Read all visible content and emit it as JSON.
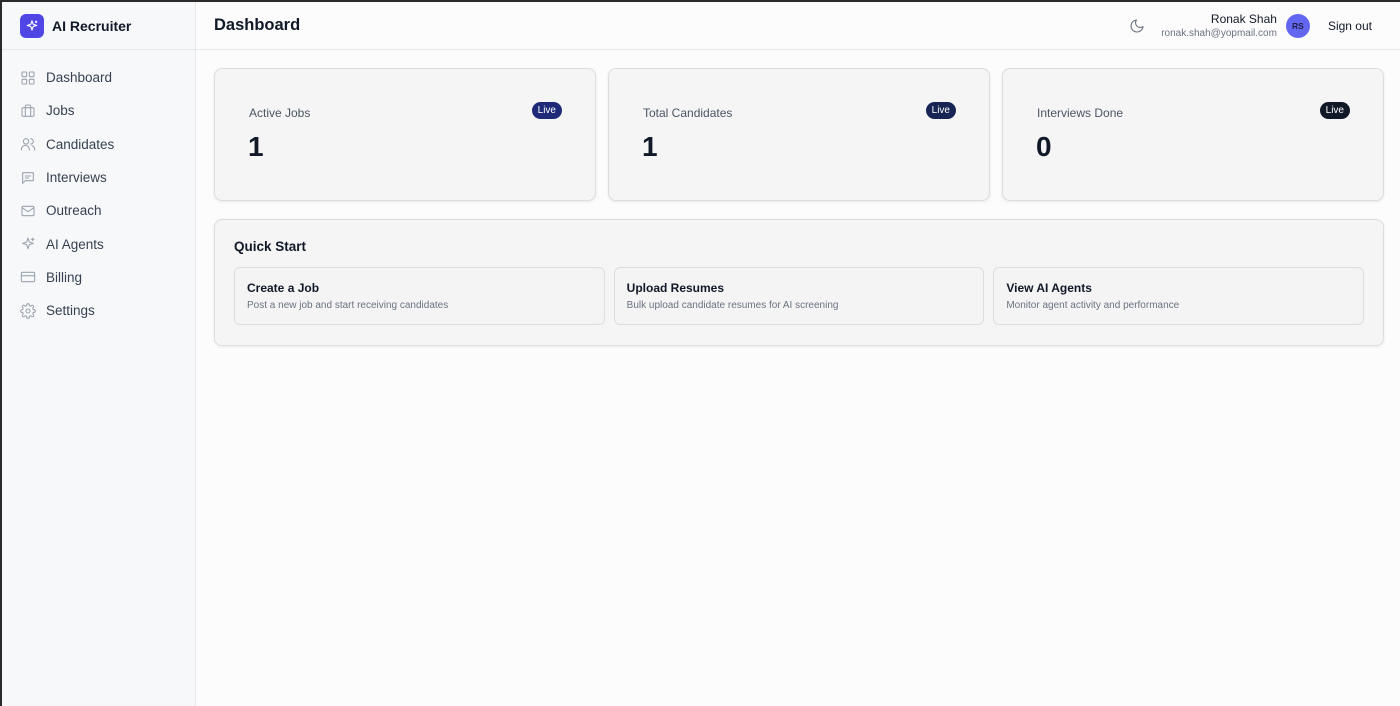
{
  "brand": {
    "name": "AI Recruiter",
    "color": "#4f46e5"
  },
  "sidebar": {
    "items": [
      {
        "label": "Dashboard",
        "icon": "grid-icon"
      },
      {
        "label": "Jobs",
        "icon": "briefcase-icon"
      },
      {
        "label": "Candidates",
        "icon": "users-icon"
      },
      {
        "label": "Interviews",
        "icon": "message-icon"
      },
      {
        "label": "Outreach",
        "icon": "mail-icon"
      },
      {
        "label": "AI Agents",
        "icon": "sparkles-icon"
      },
      {
        "label": "Billing",
        "icon": "credit-card-icon"
      },
      {
        "label": "Settings",
        "icon": "gear-icon"
      }
    ]
  },
  "header": {
    "title": "Dashboard",
    "user": {
      "name": "Ronak Shah",
      "email": "ronak.shah@yopmail.com",
      "initials": "RS"
    },
    "signout_label": "Sign out"
  },
  "stats": [
    {
      "label": "Active Jobs",
      "value": "1",
      "badge": "Live",
      "badge_color": "#1e2a78"
    },
    {
      "label": "Total Candidates",
      "value": "1",
      "badge": "Live",
      "badge_color": "#172554"
    },
    {
      "label": "Interviews Done",
      "value": "0",
      "badge": "Live",
      "badge_color": "#111827"
    }
  ],
  "quick_start": {
    "title": "Quick Start",
    "items": [
      {
        "title": "Create a Job",
        "desc": "Post a new job and start receiving candidates"
      },
      {
        "title": "Upload Resumes",
        "desc": "Bulk upload candidate resumes for AI screening"
      },
      {
        "title": "View AI Agents",
        "desc": "Monitor agent activity and performance"
      }
    ]
  }
}
